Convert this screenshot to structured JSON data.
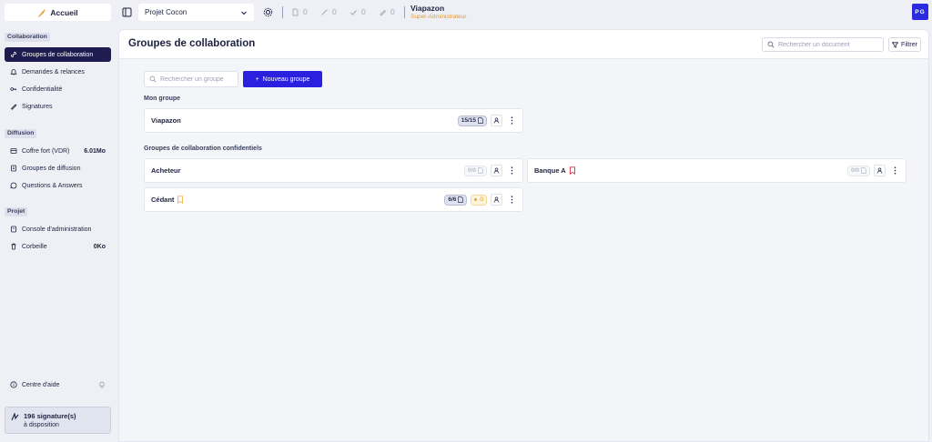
{
  "topbar": {
    "home_label": "Accueil",
    "project": "Projet Cocon",
    "counters": [
      "0",
      "0",
      "0",
      "0"
    ],
    "user_name": "Viapazon",
    "user_role": "Super-Administrateur",
    "avatar_initials": "PG"
  },
  "sidebar": {
    "sections": [
      {
        "title": "Collaboration",
        "items": [
          {
            "label": "Groupes de collaboration",
            "icon": "link-icon",
            "active": true
          },
          {
            "label": "Demandes & relances",
            "icon": "bell-icon"
          },
          {
            "label": "Confidentialité",
            "icon": "key-icon"
          },
          {
            "label": "Signatures",
            "icon": "pen-icon"
          }
        ]
      },
      {
        "title": "Diffusion",
        "items": [
          {
            "label": "Coffre fort (VDR)",
            "icon": "vault-icon",
            "value": "6.01Mo"
          },
          {
            "label": "Groupes de diffusion",
            "icon": "folder-icon"
          },
          {
            "label": "Questions & Answers",
            "icon": "chat-icon"
          }
        ]
      },
      {
        "title": "Projet",
        "items": [
          {
            "label": "Console d'administration",
            "icon": "console-icon"
          },
          {
            "label": "Corbeille",
            "icon": "trash-icon",
            "value": "0Ko"
          }
        ]
      }
    ],
    "help_label": "Centre d'aide",
    "signatures_count": "196 signature(s)",
    "signatures_sub": "à disposition"
  },
  "main": {
    "title": "Groupes de collaboration",
    "doc_search_placeholder": "Rechercher un document",
    "filter_label": "Filtrer",
    "group_search_placeholder": "Rechercher un groupe",
    "new_group_label": "Nouveau groupe",
    "my_group_title": "Mon groupe",
    "confidential_title": "Groupes de collaboration confidentiels",
    "my_group": {
      "name": "Viapazon",
      "docs": "15/15"
    },
    "confidential_groups": [
      {
        "name": "Acheteur",
        "docs": "0/0"
      },
      {
        "name": "Banque A",
        "docs": "0/0",
        "bookmark": "red"
      },
      {
        "name": "Cédant",
        "docs": "6/6",
        "bookmark": "orange",
        "pending": "0"
      }
    ]
  },
  "colors": {
    "accent": "#2b1fe0",
    "active_nav": "#1f1d4f",
    "role": "#e79a2f",
    "bookmark_red": "#e0303a",
    "bookmark_orange": "#f0b64a"
  }
}
